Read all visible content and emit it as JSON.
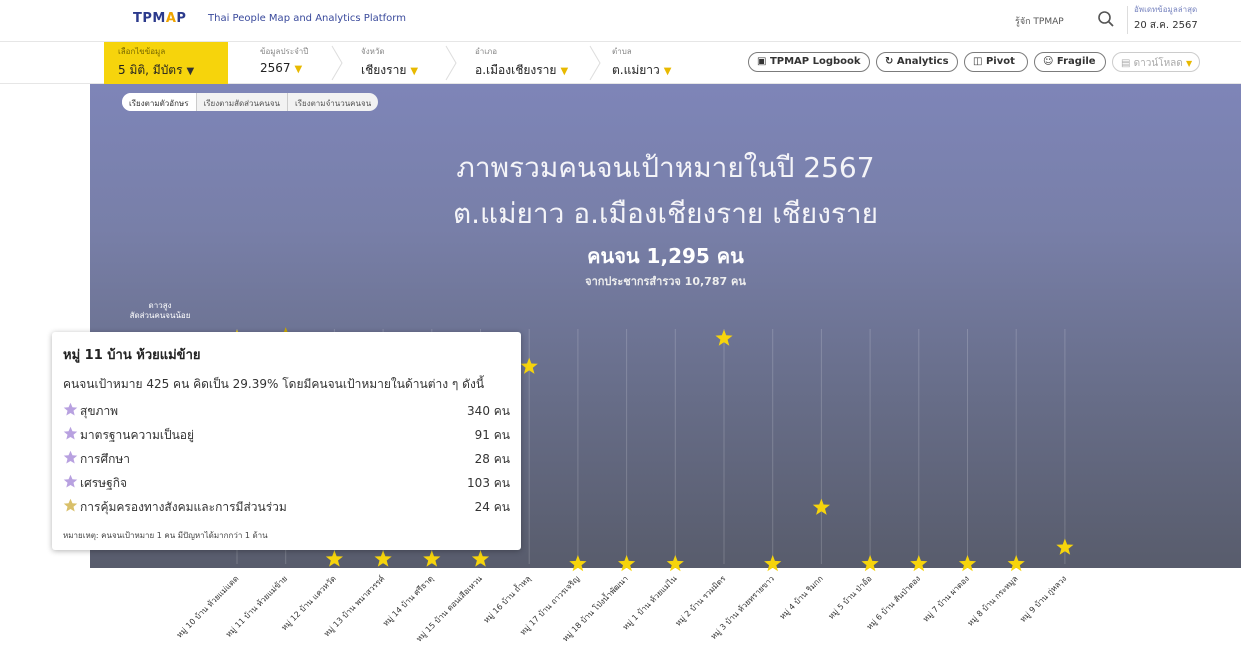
{
  "header": {
    "logo_main": "TPM",
    "logo_accent": "A",
    "logo_end": "P",
    "platform": "Thai People Map and Analytics Platform",
    "about": "รู้จัก TPMAP",
    "update_label": "อัพเดทข้อมูลล่าสุด",
    "update_date": "20 ส.ค. 2567"
  },
  "filters": {
    "data_source": {
      "label": "เลือกไขข้อมูล",
      "value": "5 มิติ, มีบัตร"
    },
    "year": {
      "label": "ข้อมูลประจำปี",
      "value": "2567"
    },
    "province": {
      "label": "จังหวัด",
      "value": "เชียงราย"
    },
    "district": {
      "label": "อำเภอ",
      "value": "อ.เมืองเชียงราย"
    },
    "subdistrict": {
      "label": "ตำบล",
      "value": "ต.แม่ยาว"
    }
  },
  "actions": {
    "logbook": "TPMAP Logbook",
    "analytics": "Analytics",
    "pivot": "Pivot",
    "fragile": "Fragile",
    "download": "ดาวน์โหลด"
  },
  "sort_tabs": [
    "เรียงตามตัวอักษร",
    "เรียงตามสัดส่วนคนจน",
    "เรียงตามจำนวนคนจน"
  ],
  "headline": {
    "line1": "ภาพรวมคนจนเป้าหมายในปี 2567",
    "line2": "ต.แม่ยาว อ.เมืองเชียงราย เชียงราย",
    "poor_count": "คนจน 1,295 คน",
    "survey": "จากประชากรสำรวจ 10,787 คน"
  },
  "axis": {
    "top_label_1": "ดาวสูง",
    "top_label_2": "สัดส่วนคนจนน้อย"
  },
  "colors": {
    "star": "#f6d40c",
    "star_hover": "#c9a800",
    "tooltip_star": "#b8a1e0"
  },
  "chart_data": {
    "type": "scatter",
    "villages": [
      "หมู่ 10 บ้าน ห้วยแม่แดด",
      "หมู่ 11 บ้าน ห้วยแม่ข้าย",
      "หมู่ 12 บ้าน แควหวัด",
      "หมู่ 13 บ้าน พนาสวรรค์",
      "หมู่ 14 บ้าน ศรีธาตุ",
      "หมู่ 15 บ้าน ดอนเสือเหวน",
      "หมู่ 16 บ้าน ถ้ำหลุ",
      "หมู่ 17 บ้าน ถาวรเจริญ",
      "หมู่ 18 บ้าน โป่งน้ำพัฒนา",
      "หมู่ 1 บ้าน ห้วยแม่ไน",
      "หมู่ 2 บ้าน รวมมิตร",
      "หมู่ 3 บ้าน ห้วยทรายขาว",
      "หมู่ 4 บ้าน ริมกก",
      "หมู่ 5 บ้าน ป่าอ้อ",
      "หมู่ 6 บ้าน สันป่าตอง",
      "หมู่ 7 บ้าน ผาตอง",
      "หมู่ 8 บ้าน กระหมูล",
      "หมู่ 9 บ้าน กู่หลวง"
    ],
    "level": [
      0.96,
      0.97,
      0.02,
      0.02,
      0.02,
      0.02,
      0.84,
      0.0,
      0.0,
      0.0,
      0.96,
      0.0,
      0.24,
      0.0,
      0.0,
      0.0,
      0.0,
      0.07
    ],
    "highlighted_index": 1
  },
  "tooltip": {
    "title": "หมู่ 11 บ้าน ห้วยแม่ข้าย",
    "summary": "คนจนเป้าหมาย 425 คน คิดเป็น 29.39% โดยมีคนจนเป้าหมายในด้านต่าง ๆ ดังนี้",
    "rows": [
      {
        "label": "สุขภาพ",
        "count": "340 คน"
      },
      {
        "label": "มาตรฐานความเป็นอยู่",
        "count": "91 คน"
      },
      {
        "label": "การศึกษา",
        "count": "28 คน"
      },
      {
        "label": "เศรษฐกิจ",
        "count": "103 คน"
      },
      {
        "label": "การคุ้มครองทางสังคมและการมีส่วนร่วม",
        "count": "24 คน"
      }
    ],
    "note": "หมายเหตุ: คนจนเป้าหมาย 1 คน มีปัญหาได้มากกว่า 1 ด้าน"
  }
}
